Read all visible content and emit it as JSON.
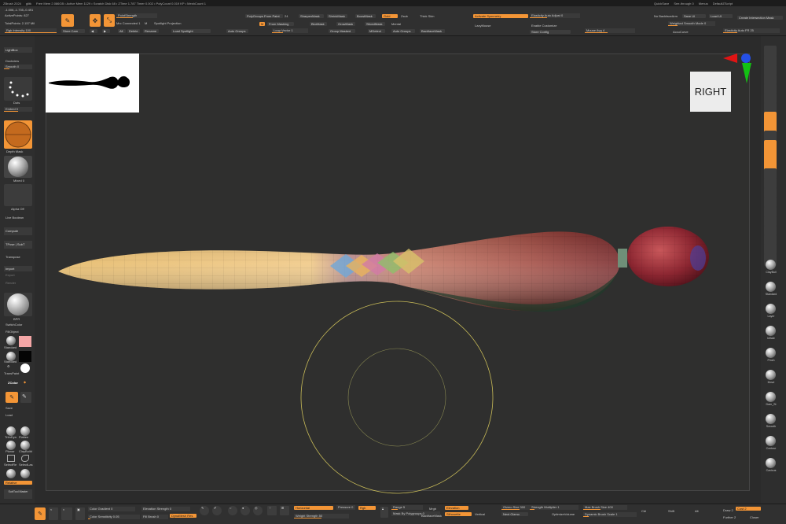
{
  "titlebar": {
    "app": "ZBrush 2024",
    "file": "glitk",
    "stats": "Free Mem 2.086GB • Active Mem 1129 • Scratch Disk 68 • ZTime 1.787 Timer 0.002 • PolyCount 0.019 KP • MeshCount 1",
    "quicksave": "QuickSave",
    "seethrough": "See-through 0",
    "menus": "Menus",
    "defaultscript": "DefaultZScript"
  },
  "topshelf": {
    "coords": "-1.006,-1.735,-0.491",
    "active_points": "ActivePoints: 827",
    "total_points": "TotalPoints: 2.157 Mil",
    "rgb_intensity": "Rgb Intensity 100",
    "store_cam": "Store Cam",
    "point_strength": "PointStrength",
    "mrc_connected": "Mrc Connected 1",
    "mrc_value": "M",
    "spotlight_projection": "Spotlight Projection",
    "all": "All",
    "delete": "Delete",
    "rename": "Rename",
    "load_spotlight": "Load Spotlight",
    "polygroups_from_paint": "PolyGroups From Paint",
    "pg_value": "24",
    "from_masking": "From Masking",
    "auto_groups": "Auto Groups",
    "loop_vector": "Loop Vector 1",
    "sharpen_mask": "SharpenMask",
    "blur_mask": "BlurMask",
    "shrink_mask": "ShrinkMask",
    "grow_mask": "GrowMask",
    "boost_mask": "BoostMask",
    "sliced_mask": "SlicedMask",
    "group_masked": "Group Masked",
    "mdetect": "MDetect",
    "gold": "Gold",
    "zsub": "Zsub",
    "mental": "Mental",
    "auto_groups2": "Auto Groups",
    "thick_skin": "Thick Skin",
    "backface_mask": "BackfaceMask",
    "activate_symmetry": "Activate Symmetry",
    "lazymouse": "LazyMouse",
    "elasticity": "Elasticity Auto Adjust 0",
    "enable_customize": "Enable Customize",
    "store_config": "Store Config",
    "mouse_avg": "Mouse Avg 4",
    "no_backface": "No BackfaceArm",
    "weighted_smooth": "Weighted Smooth Mode 0",
    "save_ui": "Save UI",
    "load_ui": "Load UI",
    "accucurve": "AccuCurve",
    "create_intersection": "Create Intersection Mask",
    "elasticity_fr": "Elasticity Auto FR 25"
  },
  "leftpanel": {
    "lightbox": "LightBox",
    "dockview": "Dockview",
    "smooth": "Smooth 0",
    "dots": "Dots",
    "embed": "Embed 0",
    "depth_mask": "Depth Mask",
    "mixed": "Mixed 0",
    "alpha_off": "Alpha Off",
    "live_boolean": "Live Boolean",
    "compute": "Compute",
    "tpose": "TPose | SubT",
    "transpose": "Transpose",
    "import": "Import",
    "export": "Export",
    "render": "Render",
    "bpr": "BPR",
    "material": "MatCap",
    "switch_color": "SwitchColor",
    "fill_object": "FillObject",
    "standard": "Standard",
    "standard2": "Standard",
    "transp": "TransPaint",
    "zcolor": "ZColor",
    "save": "Save",
    "load": "Load",
    "trimdyn": "TrimDyn",
    "flatten": "Flatten",
    "planar": "Planar",
    "claybuild": "ClayBuild",
    "selectre": "SelectRe",
    "selectlas": "SelectLas",
    "relative": "Relative",
    "subtool_master": "SubTool Master",
    "brush_1": "Standard",
    "brush_2": "Standard"
  },
  "viewport": {
    "nav_cube_label": "RIGHT"
  },
  "rightpanel": {
    "items": [
      "BPR",
      "SPix 3",
      "Scroll",
      "Zoom",
      "Actual",
      "AAHalf",
      "Dynamic",
      "Persp",
      "Floor",
      "L.Sym",
      "Frame",
      "Move",
      "Scale",
      "Rotate",
      "PolyF",
      "Transp",
      "Ghost",
      "Solo",
      "Xpose",
      "Local",
      "XYZ",
      "Y",
      "Z"
    ],
    "brushes": [
      "ClayBuil",
      "Standard",
      "Layer",
      "Inflate",
      "Pinch",
      "Move",
      "Dam_St",
      "Smooth",
      "Contour",
      "Cavicus"
    ]
  },
  "bottomshelf": {
    "color_gradient": "Color Gradient 0",
    "color_sensitivity": "Color Sensitivity 0.05",
    "elevation_strength": "Elevation Strength 0",
    "fill_brush": "Fill Brush 0",
    "dynamesh": "DynaMesh Res",
    "horizontal": "Horizontal",
    "pressure": "Pressure 0",
    "rgb": "Rgb",
    "weight_strength": "Weight Strength 50",
    "range": "Range 5",
    "mask_by_polygroups": "Mask By Polygroups 0",
    "mrgb": "Mrgb",
    "backface_mask": "BackfaceMask",
    "elevation": "Elevation",
    "silhouette": "Silhouette",
    "vertical": "Vertical",
    "gizmo_size": "Gizmo Size 300",
    "strength_multiplier": "Strength Multiplier 1",
    "next_gizmo": "Next Gizmo",
    "optimize_volume": "OptimizeVolume",
    "max_brush_size": "Max Brush Size 400",
    "dynamic_brush_scale": "Dynamic Brush Scale 1",
    "ctrl": "Ctrl",
    "shift": "Shift",
    "alt": "Alt",
    "draw_2": "Draw 2",
    "cost_2": "Cost 2",
    "further_2": "Further 2",
    "closer": "Closer",
    "size_label": "Size",
    "mask_label": "Mask"
  },
  "colors": {
    "accent": "#f39536",
    "panel": "#303030",
    "canvas": "#2f2f2e",
    "cream": "#e9c27a",
    "maroon": "#7a2b2d"
  }
}
